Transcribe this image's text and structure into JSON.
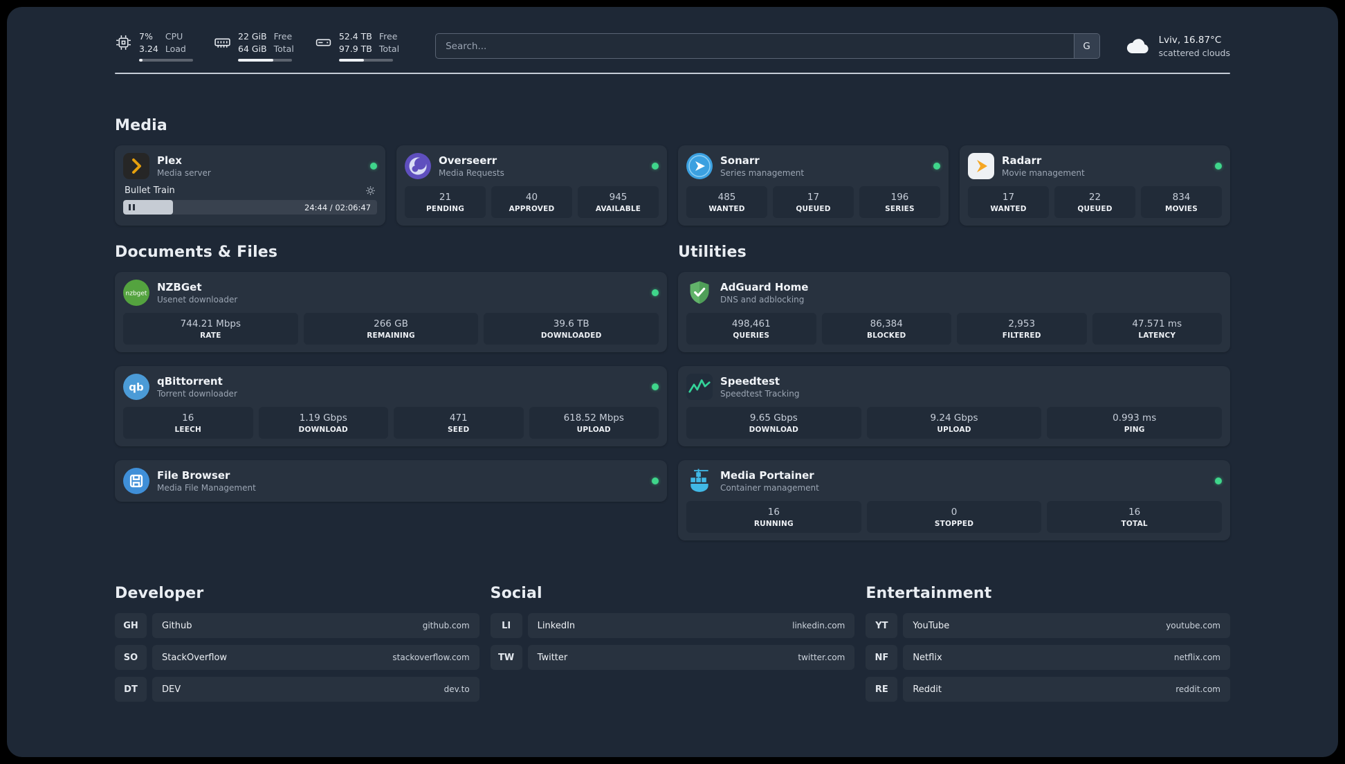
{
  "topbar": {
    "cpu": {
      "value_top": "7%",
      "value_bottom": "3.24",
      "label_top": "CPU",
      "label_bottom": "Load",
      "meter_percent": 7
    },
    "ram": {
      "value_top": "22 GiB",
      "value_bottom": "64 GiB",
      "label_top": "Free",
      "label_bottom": "Total",
      "meter_percent": 66
    },
    "disk": {
      "value_top": "52.4 TB",
      "value_bottom": "97.9 TB",
      "label_top": "Free",
      "label_bottom": "Total",
      "meter_percent": 46
    },
    "search": {
      "placeholder": "Search...",
      "engine_label": "G"
    },
    "weather": {
      "location": "Lviv, 16.87°C",
      "condition": "scattered clouds"
    }
  },
  "media_section": {
    "title": "Media",
    "plex": {
      "name": "Plex",
      "subtitle": "Media server",
      "now_playing": "Bullet Train",
      "time": "24:44 / 02:06:47",
      "progress_percent": 19.5
    },
    "cards": [
      {
        "name": "Overseerr",
        "subtitle": "Media Requests",
        "stats": [
          {
            "value": "21",
            "label": "PENDING"
          },
          {
            "value": "40",
            "label": "APPROVED"
          },
          {
            "value": "945",
            "label": "AVAILABLE"
          }
        ]
      },
      {
        "name": "Sonarr",
        "subtitle": "Series management",
        "stats": [
          {
            "value": "485",
            "label": "WANTED"
          },
          {
            "value": "17",
            "label": "QUEUED"
          },
          {
            "value": "196",
            "label": "SERIES"
          }
        ]
      },
      {
        "name": "Radarr",
        "subtitle": "Movie management",
        "stats": [
          {
            "value": "17",
            "label": "WANTED"
          },
          {
            "value": "22",
            "label": "QUEUED"
          },
          {
            "value": "834",
            "label": "MOVIES"
          }
        ]
      }
    ]
  },
  "documents_section": {
    "title": "Documents & Files",
    "cards": [
      {
        "name": "NZBGet",
        "subtitle": "Usenet downloader",
        "stats": [
          {
            "value": "744.21 Mbps",
            "label": "RATE"
          },
          {
            "value": "266 GB",
            "label": "REMAINING"
          },
          {
            "value": "39.6 TB",
            "label": "DOWNLOADED"
          }
        ]
      },
      {
        "name": "qBittorrent",
        "subtitle": "Torrent downloader",
        "stats": [
          {
            "value": "16",
            "label": "LEECH"
          },
          {
            "value": "1.19 Gbps",
            "label": "DOWNLOAD"
          },
          {
            "value": "471",
            "label": "SEED"
          },
          {
            "value": "618.52 Mbps",
            "label": "UPLOAD"
          }
        ]
      },
      {
        "name": "File Browser",
        "subtitle": "Media File Management",
        "stats": []
      }
    ]
  },
  "utilities_section": {
    "title": "Utilities",
    "cards": [
      {
        "name": "AdGuard Home",
        "subtitle": "DNS and adblocking",
        "stats": [
          {
            "value": "498,461",
            "label": "QUERIES"
          },
          {
            "value": "86,384",
            "label": "BLOCKED"
          },
          {
            "value": "2,953",
            "label": "FILTERED"
          },
          {
            "value": "47.571 ms",
            "label": "LATENCY"
          }
        ]
      },
      {
        "name": "Speedtest",
        "subtitle": "Speedtest Tracking",
        "stats": [
          {
            "value": "9.65 Gbps",
            "label": "DOWNLOAD"
          },
          {
            "value": "9.24 Gbps",
            "label": "UPLOAD"
          },
          {
            "value": "0.993 ms",
            "label": "PING"
          }
        ]
      },
      {
        "name": "Media Portainer",
        "subtitle": "Container management",
        "stats": [
          {
            "value": "16",
            "label": "RUNNING"
          },
          {
            "value": "0",
            "label": "STOPPED"
          },
          {
            "value": "16",
            "label": "TOTAL"
          }
        ]
      }
    ]
  },
  "bookmarks": [
    {
      "title": "Developer",
      "items": [
        {
          "abbr": "GH",
          "name": "Github",
          "url": "github.com"
        },
        {
          "abbr": "SO",
          "name": "StackOverflow",
          "url": "stackoverflow.com"
        },
        {
          "abbr": "DT",
          "name": "DEV",
          "url": "dev.to"
        }
      ]
    },
    {
      "title": "Social",
      "items": [
        {
          "abbr": "LI",
          "name": "LinkedIn",
          "url": "linkedin.com"
        },
        {
          "abbr": "TW",
          "name": "Twitter",
          "url": "twitter.com"
        }
      ]
    },
    {
      "title": "Entertainment",
      "items": [
        {
          "abbr": "YT",
          "name": "YouTube",
          "url": "youtube.com"
        },
        {
          "abbr": "NF",
          "name": "Netflix",
          "url": "netflix.com"
        },
        {
          "abbr": "RE",
          "name": "Reddit",
          "url": "reddit.com"
        }
      ]
    }
  ],
  "icon_text": {
    "nzbget": "nzbget",
    "qbittorrent": "qb"
  },
  "colors": {
    "status_online": "#3fd68b",
    "plex_amber": "#e5a00d",
    "adguard_green": "#62b36a",
    "portainer_blue": "#41b9e6"
  }
}
